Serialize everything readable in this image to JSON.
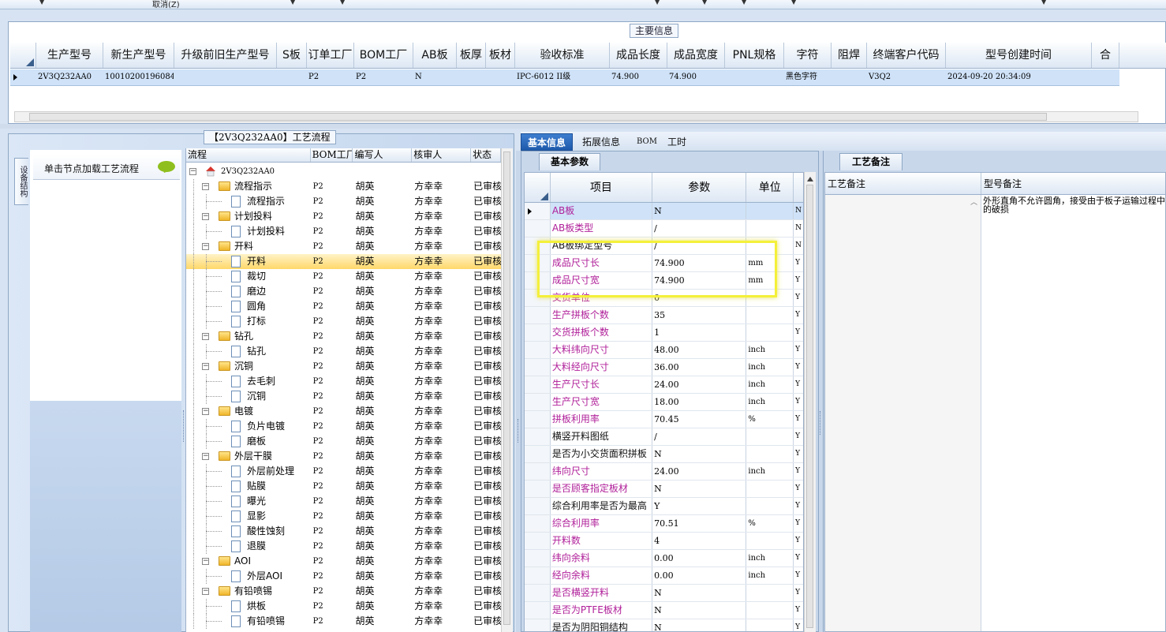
{
  "toolbar": {
    "cancel_label": "取消(Z)"
  },
  "main_info": {
    "tab_title": "主要信息",
    "columns": [
      "生产型号",
      "新生产型号",
      "升级前旧生产型号",
      "S板",
      "订单工厂",
      "BOM工厂",
      "AB板",
      "板厚",
      "板材",
      "验收标准",
      "成品长度",
      "成品宽度",
      "PNL规格",
      "字符",
      "阻焊",
      "终端客户代码",
      "型号创建时间",
      "合"
    ],
    "row": [
      "2V3Q232AA0",
      "10010200196084",
      "",
      "",
      "P2",
      "P2",
      "N",
      "",
      "",
      "IPC-6012 II级",
      "74.900",
      "74.900",
      "",
      "黑色字符",
      "",
      "V3Q2",
      "2024-09-20 20:34:09",
      ""
    ]
  },
  "flow_panel": {
    "tab_title": "【2V3Q232AA0】工艺流程",
    "side_label": "设备结构",
    "loader_label": "单击节点加载工艺流程",
    "columns": [
      "流程",
      "BOM工厂",
      "编写人",
      "核审人",
      "状态"
    ],
    "rows": [
      {
        "name": "2V3Q232AA0",
        "level": 0,
        "type": "root",
        "bom": "",
        "writer": "",
        "reviewer": "",
        "status": ""
      },
      {
        "name": "流程指示",
        "level": 1,
        "type": "folder",
        "bom": "P2",
        "writer": "胡英",
        "reviewer": "方幸幸",
        "status": "已审核"
      },
      {
        "name": "流程指示",
        "level": 2,
        "type": "doc",
        "bom": "P2",
        "writer": "胡英",
        "reviewer": "方幸幸",
        "status": "已审核"
      },
      {
        "name": "计划投料",
        "level": 1,
        "type": "folder",
        "bom": "P2",
        "writer": "胡英",
        "reviewer": "方幸幸",
        "status": "已审核"
      },
      {
        "name": "计划投料",
        "level": 2,
        "type": "doc",
        "bom": "P2",
        "writer": "胡英",
        "reviewer": "方幸幸",
        "status": "已审核"
      },
      {
        "name": "开料",
        "level": 1,
        "type": "folder",
        "bom": "P2",
        "writer": "胡英",
        "reviewer": "方幸幸",
        "status": "已审核"
      },
      {
        "name": "开料",
        "level": 2,
        "type": "doc",
        "bom": "P2",
        "writer": "胡英",
        "reviewer": "方幸幸",
        "status": "已审核",
        "selected": true
      },
      {
        "name": "裁切",
        "level": 2,
        "type": "doc",
        "bom": "P2",
        "writer": "胡英",
        "reviewer": "方幸幸",
        "status": "已审核"
      },
      {
        "name": "磨边",
        "level": 2,
        "type": "doc",
        "bom": "P2",
        "writer": "胡英",
        "reviewer": "方幸幸",
        "status": "已审核"
      },
      {
        "name": "圆角",
        "level": 2,
        "type": "doc",
        "bom": "P2",
        "writer": "胡英",
        "reviewer": "方幸幸",
        "status": "已审核"
      },
      {
        "name": "打标",
        "level": 2,
        "type": "doc",
        "bom": "P2",
        "writer": "胡英",
        "reviewer": "方幸幸",
        "status": "已审核"
      },
      {
        "name": "钻孔",
        "level": 1,
        "type": "folder",
        "bom": "P2",
        "writer": "胡英",
        "reviewer": "方幸幸",
        "status": "已审核"
      },
      {
        "name": "钻孔",
        "level": 2,
        "type": "doc",
        "bom": "P2",
        "writer": "胡英",
        "reviewer": "方幸幸",
        "status": "已审核"
      },
      {
        "name": "沉铜",
        "level": 1,
        "type": "folder",
        "bom": "P2",
        "writer": "胡英",
        "reviewer": "方幸幸",
        "status": "已审核"
      },
      {
        "name": "去毛刺",
        "level": 2,
        "type": "doc",
        "bom": "P2",
        "writer": "胡英",
        "reviewer": "方幸幸",
        "status": "已审核"
      },
      {
        "name": "沉铜",
        "level": 2,
        "type": "doc",
        "bom": "P2",
        "writer": "胡英",
        "reviewer": "方幸幸",
        "status": "已审核"
      },
      {
        "name": "电镀",
        "level": 1,
        "type": "folder",
        "bom": "P2",
        "writer": "胡英",
        "reviewer": "方幸幸",
        "status": "已审核"
      },
      {
        "name": "负片电镀",
        "level": 2,
        "type": "doc",
        "bom": "P2",
        "writer": "胡英",
        "reviewer": "方幸幸",
        "status": "已审核"
      },
      {
        "name": "磨板",
        "level": 2,
        "type": "doc",
        "bom": "P2",
        "writer": "胡英",
        "reviewer": "方幸幸",
        "status": "已审核"
      },
      {
        "name": "外层干膜",
        "level": 1,
        "type": "folder",
        "bom": "P2",
        "writer": "胡英",
        "reviewer": "方幸幸",
        "status": "已审核"
      },
      {
        "name": "外层前处理",
        "level": 2,
        "type": "doc",
        "bom": "P2",
        "writer": "胡英",
        "reviewer": "方幸幸",
        "status": "已审核"
      },
      {
        "name": "贴膜",
        "level": 2,
        "type": "doc",
        "bom": "P2",
        "writer": "胡英",
        "reviewer": "方幸幸",
        "status": "已审核"
      },
      {
        "name": "曝光",
        "level": 2,
        "type": "doc",
        "bom": "P2",
        "writer": "胡英",
        "reviewer": "方幸幸",
        "status": "已审核"
      },
      {
        "name": "显影",
        "level": 2,
        "type": "doc",
        "bom": "P2",
        "writer": "胡英",
        "reviewer": "方幸幸",
        "status": "已审核"
      },
      {
        "name": "酸性蚀刻",
        "level": 2,
        "type": "doc",
        "bom": "P2",
        "writer": "胡英",
        "reviewer": "方幸幸",
        "status": "已审核"
      },
      {
        "name": "退膜",
        "level": 2,
        "type": "doc",
        "bom": "P2",
        "writer": "胡英",
        "reviewer": "方幸幸",
        "status": "已审核"
      },
      {
        "name": "AOI",
        "level": 1,
        "type": "folder",
        "bom": "P2",
        "writer": "胡英",
        "reviewer": "方幸幸",
        "status": "已审核"
      },
      {
        "name": "外层AOI",
        "level": 2,
        "type": "doc",
        "bom": "P2",
        "writer": "胡英",
        "reviewer": "方幸幸",
        "status": "已审核"
      },
      {
        "name": "有铅喷锡",
        "level": 1,
        "type": "folder",
        "bom": "P2",
        "writer": "胡英",
        "reviewer": "方幸幸",
        "status": "已审核"
      },
      {
        "name": "烘板",
        "level": 2,
        "type": "doc",
        "bom": "P2",
        "writer": "胡英",
        "reviewer": "方幸幸",
        "status": "已审核"
      },
      {
        "name": "有铅喷锡",
        "level": 2,
        "type": "doc",
        "bom": "P2",
        "writer": "胡英",
        "reviewer": "方幸幸",
        "status": "已审核"
      }
    ]
  },
  "right_tabs": [
    "基本信息",
    "拓展信息",
    "BOM",
    "工时"
  ],
  "basic_params": {
    "tab_title": "基本参数",
    "columns": [
      "项目",
      "参数",
      "单位"
    ],
    "rows": [
      {
        "item": "AB板",
        "value": "N",
        "unit": "",
        "flag": "N",
        "color": "magenta",
        "current": true
      },
      {
        "item": "AB板类型",
        "value": "/",
        "unit": "",
        "flag": "N",
        "color": "magenta"
      },
      {
        "item": "AB板绑定型号",
        "value": "/",
        "unit": "",
        "flag": "N",
        "color": "normal"
      },
      {
        "item": "成品尺寸长",
        "value": "74.900",
        "unit": "mm",
        "flag": "Y",
        "color": "magenta"
      },
      {
        "item": "成品尺寸宽",
        "value": "74.900",
        "unit": "mm",
        "flag": "Y",
        "color": "magenta"
      },
      {
        "item": "交货单位",
        "value": "0",
        "unit": "",
        "flag": "Y",
        "color": "magenta"
      },
      {
        "item": "生产拼板个数",
        "value": "35",
        "unit": "",
        "flag": "Y",
        "color": "magenta"
      },
      {
        "item": "交货拼板个数",
        "value": "1",
        "unit": "",
        "flag": "Y",
        "color": "magenta"
      },
      {
        "item": "大料纬向尺寸",
        "value": "48.00",
        "unit": "inch",
        "flag": "Y",
        "color": "magenta"
      },
      {
        "item": "大料经向尺寸",
        "value": "36.00",
        "unit": "inch",
        "flag": "Y",
        "color": "magenta"
      },
      {
        "item": "生产尺寸长",
        "value": "24.00",
        "unit": "inch",
        "flag": "Y",
        "color": "magenta"
      },
      {
        "item": "生产尺寸宽",
        "value": "18.00",
        "unit": "inch",
        "flag": "Y",
        "color": "magenta"
      },
      {
        "item": "拼板利用率",
        "value": "70.45",
        "unit": "%",
        "flag": "Y",
        "color": "magenta"
      },
      {
        "item": "横竖开料图纸",
        "value": "/",
        "unit": "",
        "flag": "Y",
        "color": "normal"
      },
      {
        "item": "是否为小交货面积拼板",
        "value": "N",
        "unit": "",
        "flag": "Y",
        "color": "normal"
      },
      {
        "item": "纬向尺寸",
        "value": "24.00",
        "unit": "inch",
        "flag": "Y",
        "color": "magenta"
      },
      {
        "item": "是否顾客指定板材",
        "value": "N",
        "unit": "",
        "flag": "Y",
        "color": "magenta"
      },
      {
        "item": "综合利用率是否为最高",
        "value": "Y",
        "unit": "",
        "flag": "Y",
        "color": "normal"
      },
      {
        "item": "综合利用率",
        "value": "70.51",
        "unit": "%",
        "flag": "Y",
        "color": "magenta"
      },
      {
        "item": "开料数",
        "value": "4",
        "unit": "",
        "flag": "Y",
        "color": "magenta"
      },
      {
        "item": "纬向余料",
        "value": "0.00",
        "unit": "inch",
        "flag": "Y",
        "color": "magenta"
      },
      {
        "item": "经向余料",
        "value": "0.00",
        "unit": "inch",
        "flag": "Y",
        "color": "magenta"
      },
      {
        "item": "是否横竖开料",
        "value": "N",
        "unit": "",
        "flag": "Y",
        "color": "magenta"
      },
      {
        "item": "是否为PTFE板材",
        "value": "N",
        "unit": "",
        "flag": "Y",
        "color": "magenta"
      },
      {
        "item": "是否为阴阳铜结构",
        "value": "N",
        "unit": "",
        "flag": "Y",
        "color": "normal"
      }
    ]
  },
  "process_remark": {
    "tab_title": "工艺备注",
    "columns": [
      "工艺备注",
      "型号备注"
    ],
    "model_remark": "外形直角不允许圆角，接受由于板子运输过程中的破损"
  },
  "colors": {
    "magenta": "#b0209a",
    "selection": "#cfe2f8",
    "highlight": "#f4f03a",
    "active_tab": "#2a67ba"
  }
}
